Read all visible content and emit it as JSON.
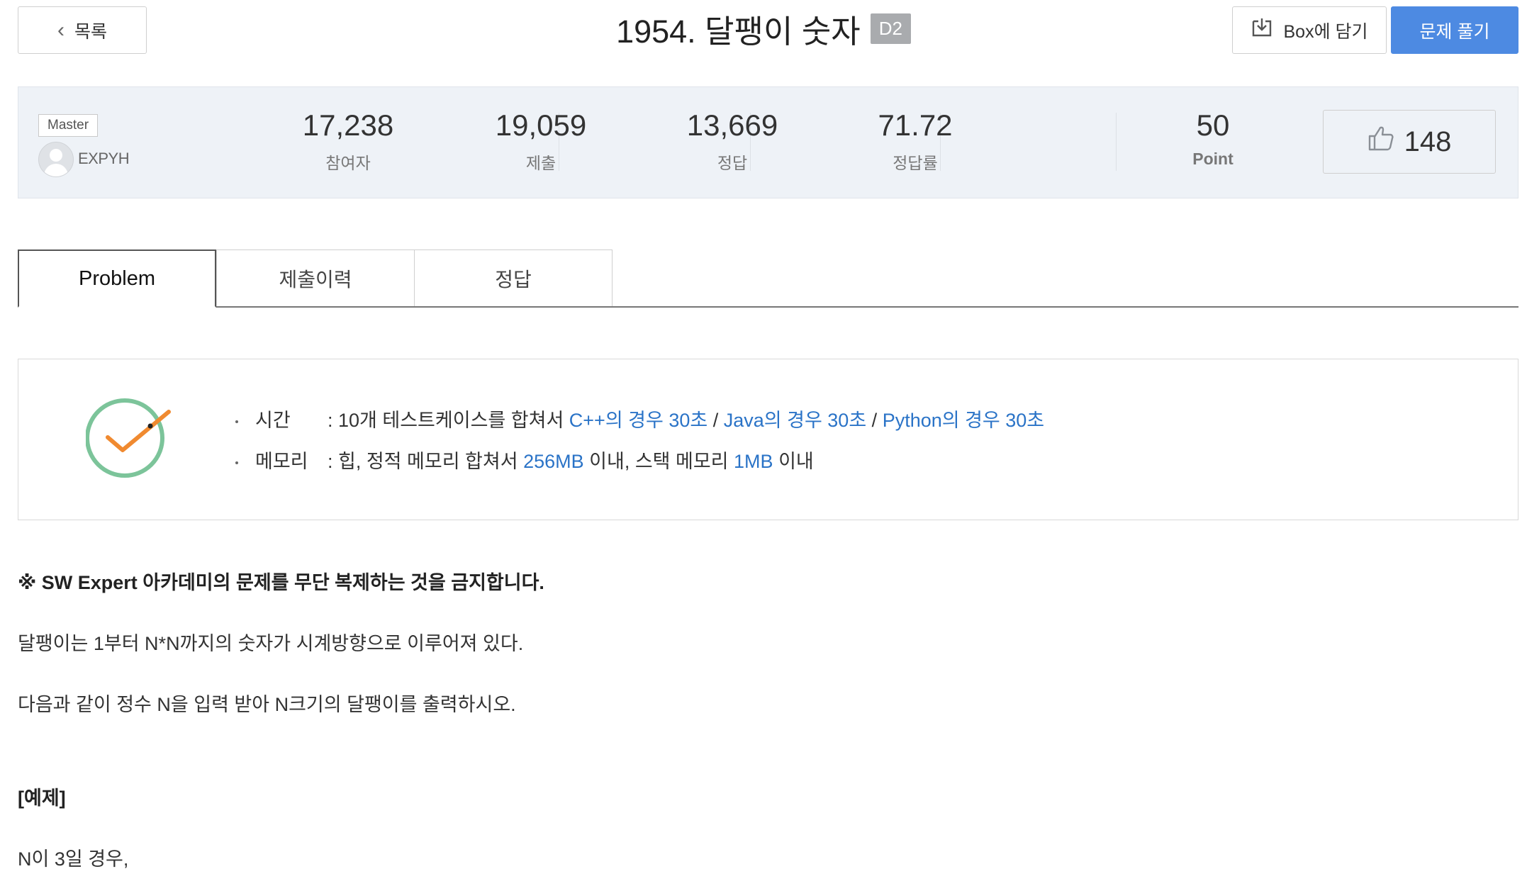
{
  "header": {
    "back_label": "목록",
    "title": "1954. 달팽이 숫자",
    "difficulty": "D2",
    "box_label": "Box에 담기",
    "solve_label": "문제 풀기"
  },
  "stats": {
    "level": "Master",
    "author": "EXPYH",
    "participants": "17,238",
    "participants_label": "참여자",
    "submissions": "19,059",
    "submissions_label": "제출",
    "correct": "13,669",
    "correct_label": "정답",
    "rate": "71.72",
    "rate_label": "정답률",
    "point": "50",
    "point_label": "Point",
    "likes": "148"
  },
  "tabs": [
    {
      "label": "Problem",
      "active": true
    },
    {
      "label": "제출이력",
      "active": false
    },
    {
      "label": "정답",
      "active": false
    }
  ],
  "limits": {
    "time_label": "시간",
    "time_prefix": ": 10개 테스트케이스를 합쳐서 ",
    "cpp": "C++의 경우 30초",
    "sep1": " / ",
    "java": "Java의 경우 30초",
    "sep2": " / ",
    "python": "Python의 경우 30초",
    "mem_label": "메모리",
    "mem_prefix": ": 힙, 정적 메모리 합쳐서 ",
    "heap": "256MB",
    "mem_mid": " 이내, 스택 메모리 ",
    "stack": "1MB",
    "mem_suffix": " 이내"
  },
  "body": {
    "notice": "※ SW Expert 아카데미의 문제를 무단 복제하는 것을 금지합니다.",
    "p1": "달팽이는 1부터 N*N까지의 숫자가 시계방향으로 이루어져 있다.",
    "p2": "다음과 같이 정수 N을 입력 받아 N크기의 달팽이를 출력하시오.",
    "example_heading": "[예제]",
    "p3": "N이 3일 경우,"
  },
  "colors": {
    "accent": "#4d8ae2",
    "link": "#2a73c7",
    "check_circle": "#7cc49a",
    "check_mark": "#f08a30"
  }
}
